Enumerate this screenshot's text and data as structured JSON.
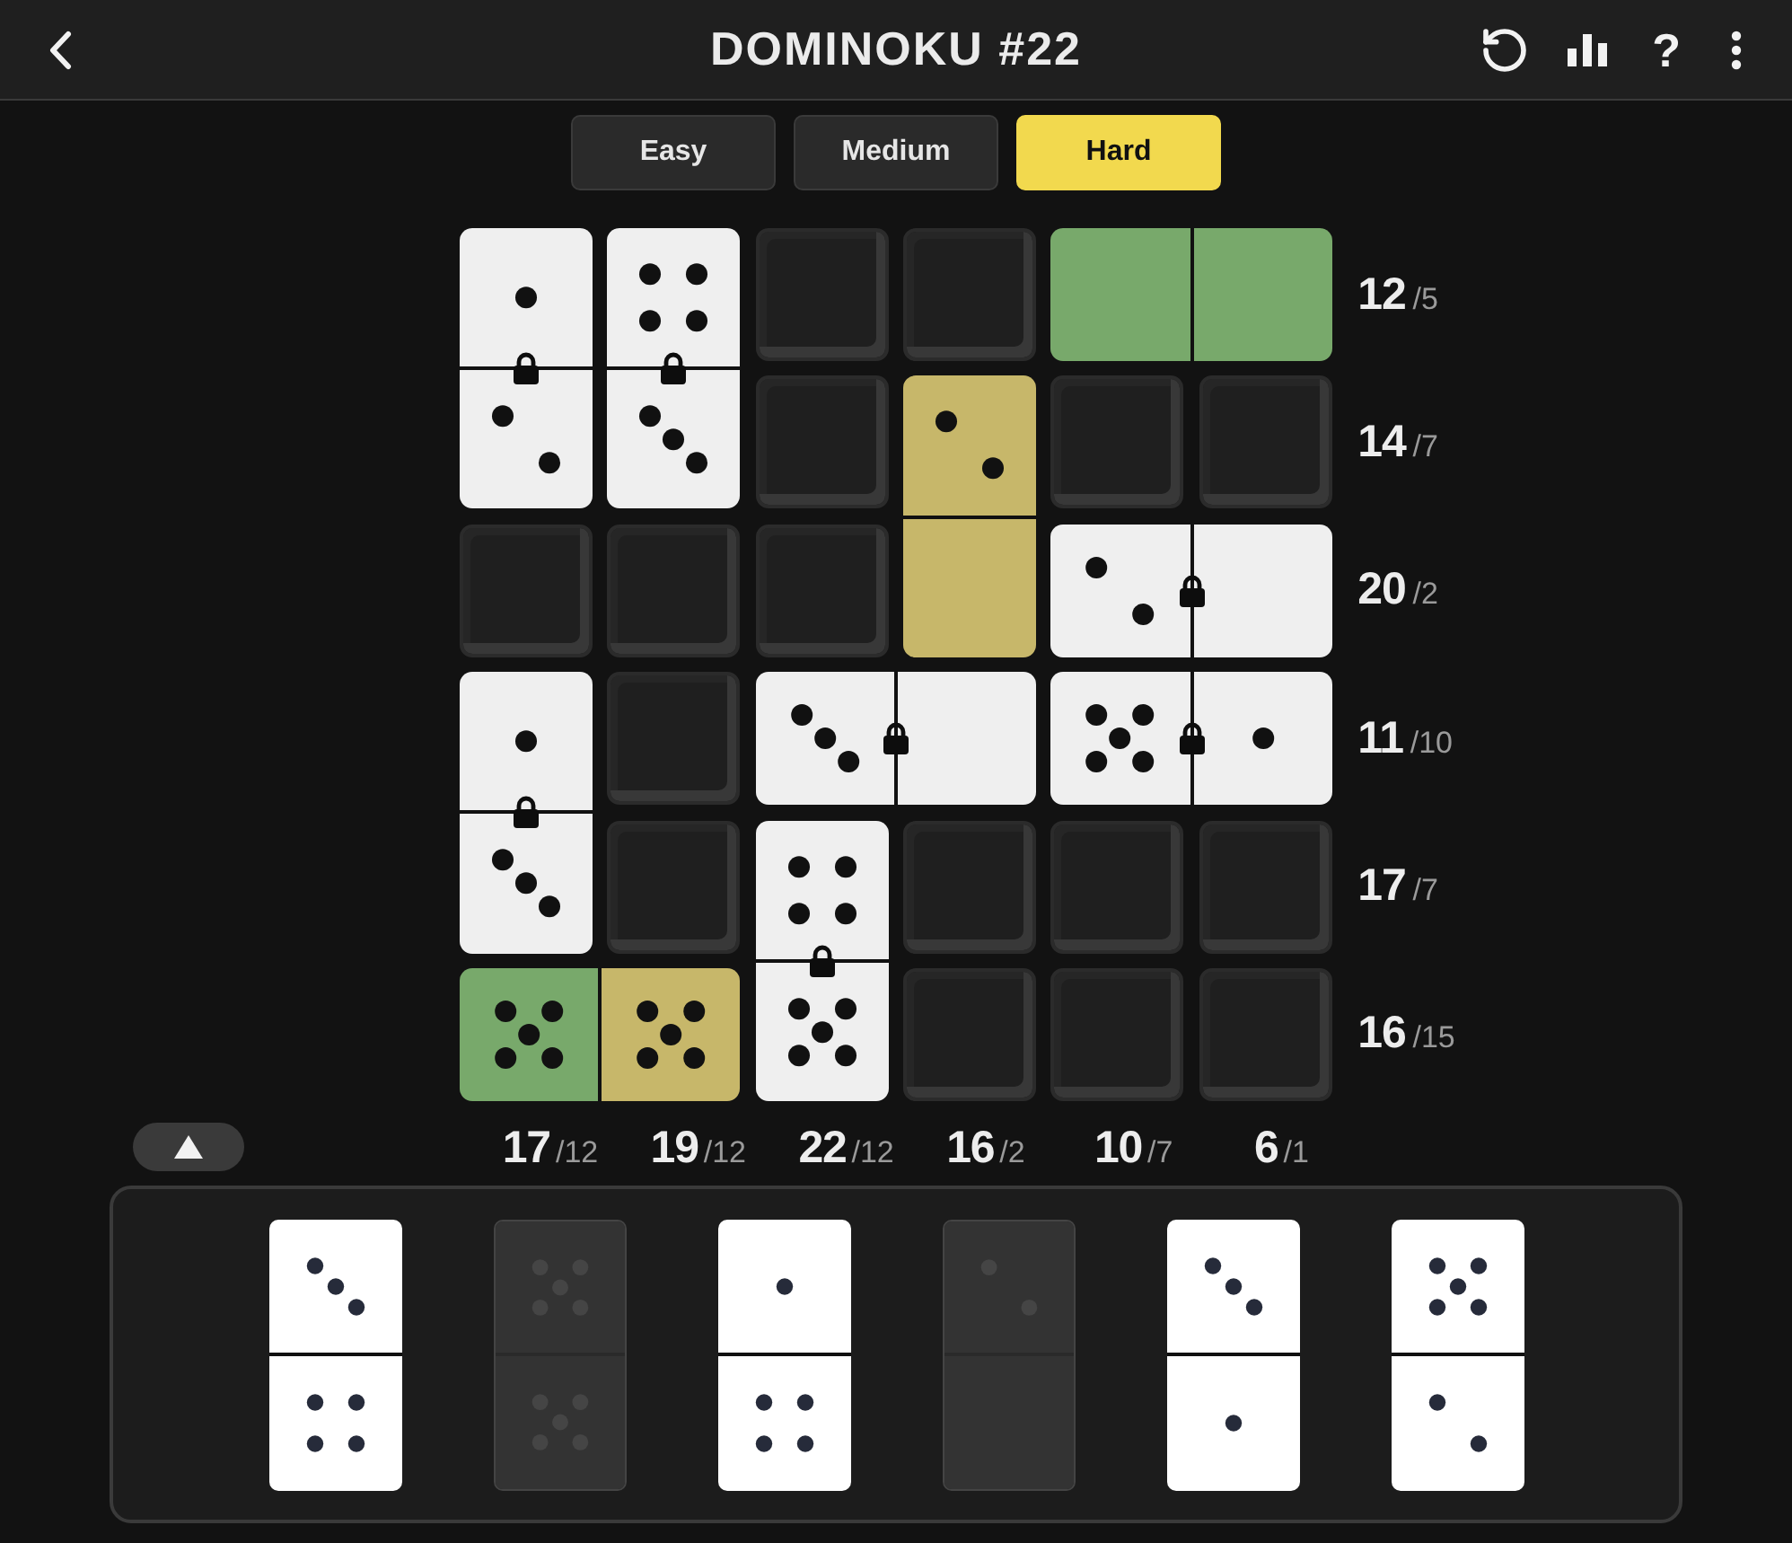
{
  "header": {
    "title": "DOMINOKU #22",
    "help_label": "?"
  },
  "difficulties": [
    {
      "label": "Easy",
      "selected": false
    },
    {
      "label": "Medium",
      "selected": false
    },
    {
      "label": "Hard",
      "selected": true
    }
  ],
  "board": {
    "rows": [
      {
        "pieces": [
          {
            "kind": "vertical",
            "locked": true,
            "halves": [
              {
                "kind": "one",
                "color": "#efefef"
              },
              {
                "kind": "two",
                "color": "#efefef"
              }
            ]
          },
          {
            "kind": "vertical",
            "locked": true,
            "halves": [
              {
                "kind": "four",
                "color": "#efefef"
              },
              {
                "kind": "three",
                "color": "#efefef"
              }
            ]
          },
          {
            "kind": "empty"
          },
          {
            "kind": "empty"
          },
          {
            "kind": "horizontal",
            "locked": false,
            "halves": [
              {
                "kind": "blank",
                "color": "#78a96b"
              },
              {
                "kind": "blank",
                "color": "#78a96b"
              }
            ]
          }
        ],
        "total": "12",
        "count": "/5"
      },
      {
        "pieces": [
          {
            "kind": "empty"
          },
          {
            "kind": "vertical",
            "locked": false,
            "halves": [
              {
                "kind": "two",
                "color": "#c7b76a"
              },
              {
                "kind": "blank",
                "color": "#c7b76a"
              }
            ]
          },
          {
            "kind": "empty"
          },
          {
            "kind": "empty"
          }
        ],
        "total": "14",
        "count": "/7"
      },
      {
        "pieces": [
          {
            "kind": "empty"
          },
          {
            "kind": "empty"
          },
          {
            "kind": "empty"
          },
          {
            "kind": "horizontal",
            "locked": true,
            "halves": [
              {
                "kind": "two",
                "color": "#efefef"
              },
              {
                "kind": "blank",
                "color": "#efefef"
              }
            ]
          }
        ],
        "total": "20",
        "count": "/2"
      },
      {
        "pieces": [
          {
            "kind": "vertical",
            "locked": true,
            "halves": [
              {
                "kind": "one",
                "color": "#efefef"
              },
              {
                "kind": "three",
                "color": "#efefef"
              }
            ]
          },
          {
            "kind": "empty"
          },
          {
            "kind": "horizontal",
            "locked": true,
            "halves": [
              {
                "kind": "three",
                "color": "#efefef"
              },
              {
                "kind": "blank",
                "color": "#efefef"
              }
            ]
          },
          {
            "kind": "horizontal",
            "locked": true,
            "halves": [
              {
                "kind": "five",
                "color": "#efefef"
              },
              {
                "kind": "one",
                "color": "#efefef"
              }
            ]
          }
        ],
        "total": "11",
        "count": "/10"
      },
      {
        "pieces": [
          {
            "kind": "empty"
          },
          {
            "kind": "vertical",
            "locked": true,
            "halves": [
              {
                "kind": "four",
                "color": "#efefef"
              },
              {
                "kind": "five",
                "color": "#efefef"
              }
            ]
          },
          {
            "kind": "empty"
          },
          {
            "kind": "empty"
          },
          {
            "kind": "empty"
          }
        ],
        "total": "17",
        "count": "/7"
      },
      {
        "pieces": [
          {
            "kind": "horizontal",
            "locked": false,
            "halves": [
              {
                "kind": "five",
                "color": "#78a96b"
              },
              {
                "kind": "five",
                "color": "#c7b76a"
              }
            ]
          },
          {
            "kind": "empty"
          },
          {
            "kind": "empty"
          },
          {
            "kind": "empty"
          }
        ],
        "total": "16",
        "count": "/15"
      }
    ],
    "columns": [
      {
        "total": "17",
        "count": "/12"
      },
      {
        "total": "19",
        "count": "/12"
      },
      {
        "total": "22",
        "count": "/12"
      },
      {
        "total": "16",
        "count": "/2"
      },
      {
        "total": "10",
        "count": "/7"
      },
      {
        "total": "6",
        "count": "/1"
      }
    ]
  },
  "tray": [
    {
      "used": false,
      "halves": [
        {
          "kind": "three"
        },
        {
          "kind": "four"
        }
      ]
    },
    {
      "used": true,
      "halves": [
        {
          "kind": "five"
        },
        {
          "kind": "five"
        }
      ]
    },
    {
      "used": false,
      "halves": [
        {
          "kind": "one"
        },
        {
          "kind": "four"
        }
      ]
    },
    {
      "used": true,
      "halves": [
        {
          "kind": "two"
        },
        {
          "kind": "blank"
        }
      ]
    },
    {
      "used": false,
      "halves": [
        {
          "kind": "three"
        },
        {
          "kind": "one"
        }
      ]
    },
    {
      "used": false,
      "halves": [
        {
          "kind": "five"
        },
        {
          "kind": "two"
        }
      ]
    }
  ]
}
